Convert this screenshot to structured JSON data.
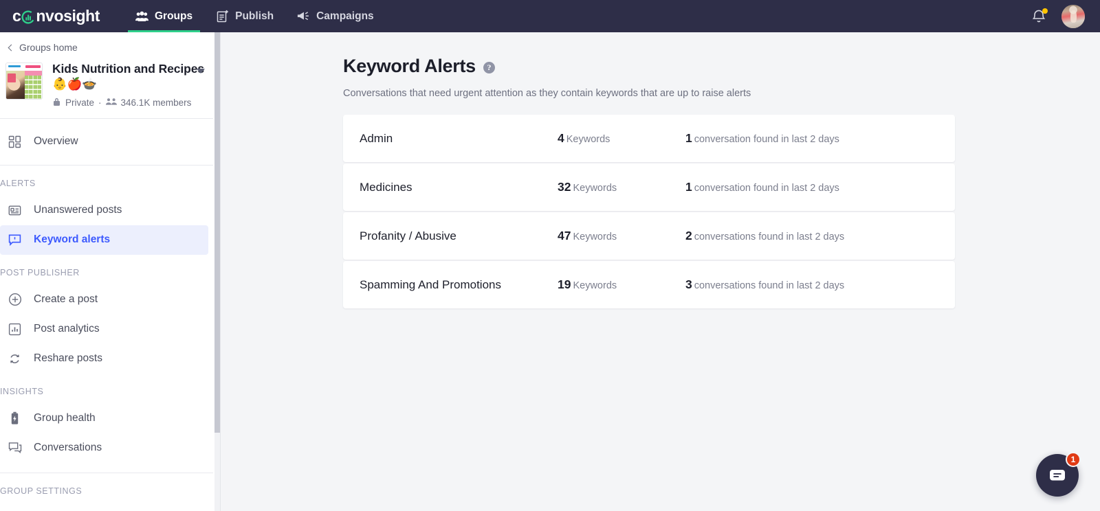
{
  "topnav": {
    "brand": "convosight",
    "brand_mark_icon": "bar-chart-circle-icon",
    "items": [
      {
        "label": "Groups",
        "icon": "people-group-icon",
        "active": true
      },
      {
        "label": "Publish",
        "icon": "document-plus-icon",
        "active": false
      },
      {
        "label": "Campaigns",
        "icon": "megaphone-icon",
        "active": false
      }
    ],
    "notification_icon": "bell-icon",
    "notification_has_badge": true,
    "avatar_icon": "user-avatar",
    "background_color": "#2e2e48",
    "active_indicator_color": "#2fd08b"
  },
  "sidebar": {
    "back_label": "Groups home",
    "back_icon": "chevron-left-icon",
    "group": {
      "name": "Kids Nutrition and Recipes 👶🍎🍲",
      "privacy": "Private",
      "privacy_icon": "lock-icon",
      "separator": "·",
      "members_icon": "people-icon",
      "members": "346.1K members",
      "caret_icon": "chevron-down-icon",
      "thumbnail_icon": "group-cover-thumbnail"
    },
    "nav": [
      {
        "section": null,
        "items": [
          {
            "label": "Overview",
            "icon": "dashboard-grid-icon",
            "active": false
          }
        ]
      },
      {
        "section": "ALERTS",
        "items": [
          {
            "label": "Unanswered posts",
            "icon": "post-card-icon",
            "active": false
          },
          {
            "label": "Keyword alerts",
            "icon": "alert-bubble-icon",
            "active": true
          }
        ]
      },
      {
        "section": "POST PUBLISHER",
        "items": [
          {
            "label": "Create a post",
            "icon": "plus-circle-icon",
            "active": false
          },
          {
            "label": "Post analytics",
            "icon": "bar-chart-icon",
            "active": false
          },
          {
            "label": "Reshare posts",
            "icon": "refresh-icon",
            "active": false
          }
        ]
      },
      {
        "section": "INSIGHTS",
        "items": [
          {
            "label": "Group health",
            "icon": "battery-bolt-icon",
            "active": false
          },
          {
            "label": "Conversations",
            "icon": "chat-bubbles-icon",
            "active": false
          }
        ]
      },
      {
        "section": "GROUP SETTINGS",
        "items": []
      }
    ],
    "active_item_bg": "#eceffd",
    "active_item_color": "#3d5afe"
  },
  "main": {
    "title": "Keyword Alerts",
    "help_icon": "help-circle-icon",
    "help_glyph": "?",
    "subtitle": "Conversations that need urgent attention as they contain keywords that are up to raise alerts",
    "cards": [
      {
        "name": "Admin",
        "keyword_count": "4",
        "keyword_label": "Keywords",
        "conversation_count": "1",
        "conversation_label": "conversation found in last 2 days"
      },
      {
        "name": "Medicines",
        "keyword_count": "32",
        "keyword_label": "Keywords",
        "conversation_count": "1",
        "conversation_label": "conversation found in last 2 days"
      },
      {
        "name": "Profanity / Abusive",
        "keyword_count": "47",
        "keyword_label": "Keywords",
        "conversation_count": "2",
        "conversation_label": "conversations found in last 2 days"
      },
      {
        "name": "Spamming And Promotions",
        "keyword_count": "19",
        "keyword_label": "Keywords",
        "conversation_count": "3",
        "conversation_label": "conversations found in last 2 days"
      }
    ]
  },
  "chat_widget": {
    "icon": "chat-bubble-icon",
    "badge_count": "1",
    "background_color": "#2e2e48",
    "badge_color": "#e03a14"
  }
}
